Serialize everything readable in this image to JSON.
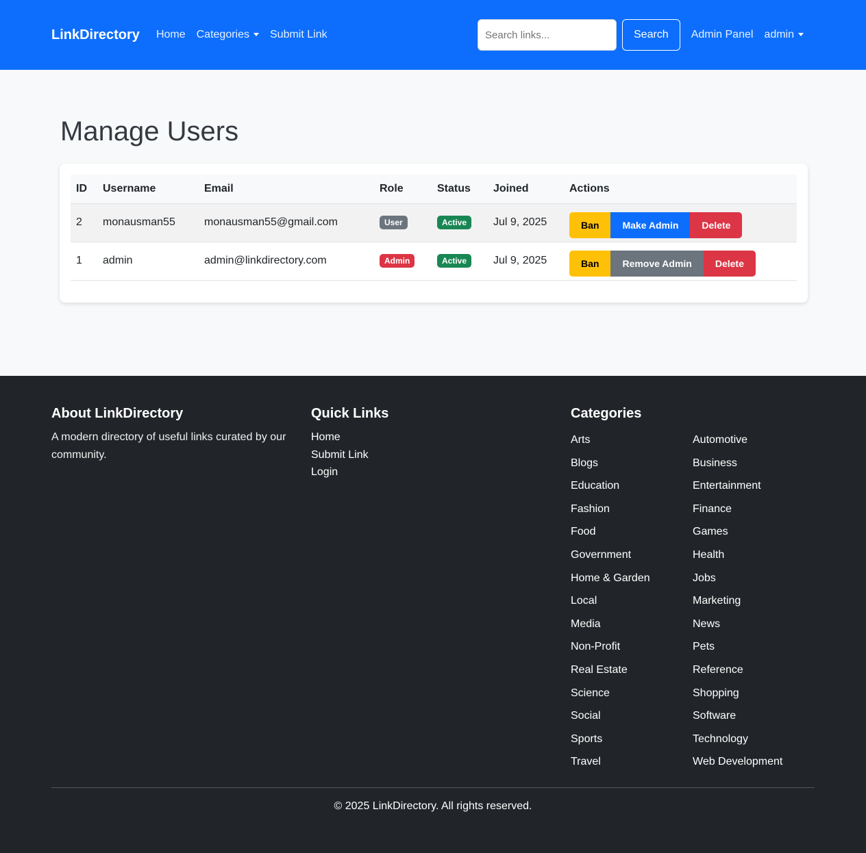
{
  "nav": {
    "brand": "LinkDirectory",
    "home": "Home",
    "categories": "Categories",
    "submit": "Submit Link",
    "search_placeholder": "Search links...",
    "search_btn": "Search",
    "admin_panel": "Admin Panel",
    "user": "admin"
  },
  "page": {
    "title": "Manage Users"
  },
  "table": {
    "headers": [
      "ID",
      "Username",
      "Email",
      "Role",
      "Status",
      "Joined",
      "Actions"
    ],
    "rows": [
      {
        "id": "2",
        "username": "monausman55",
        "email": "monausman55@gmail.com",
        "role": "User",
        "status": "Active",
        "joined": "Jul 9, 2025",
        "actions": [
          "Ban",
          "Make Admin",
          "Delete"
        ]
      },
      {
        "id": "1",
        "username": "admin",
        "email": "admin@linkdirectory.com",
        "role": "Admin",
        "status": "Active",
        "joined": "Jul 9, 2025",
        "actions": [
          "Ban",
          "Remove Admin",
          "Delete"
        ]
      }
    ]
  },
  "footer": {
    "about_title": "About LinkDirectory",
    "about_text": "A modern directory of useful links curated by our community.",
    "quick_title": "Quick Links",
    "quick": [
      "Home",
      "Submit Link",
      "Login"
    ],
    "cat_title": "Categories",
    "categories": [
      "Arts",
      "Automotive",
      "Blogs",
      "Business",
      "Education",
      "Entertainment",
      "Fashion",
      "Finance",
      "Food",
      "Games",
      "Government",
      "Health",
      "Home & Garden",
      "Jobs",
      "Local",
      "Marketing",
      "Media",
      "News",
      "Non-Profit",
      "Pets",
      "Real Estate",
      "Reference",
      "Science",
      "Shopping",
      "Social",
      "Software",
      "Sports",
      "Technology",
      "Travel",
      "Web Development"
    ],
    "copyright": "© 2025 LinkDirectory. All rights reserved."
  }
}
